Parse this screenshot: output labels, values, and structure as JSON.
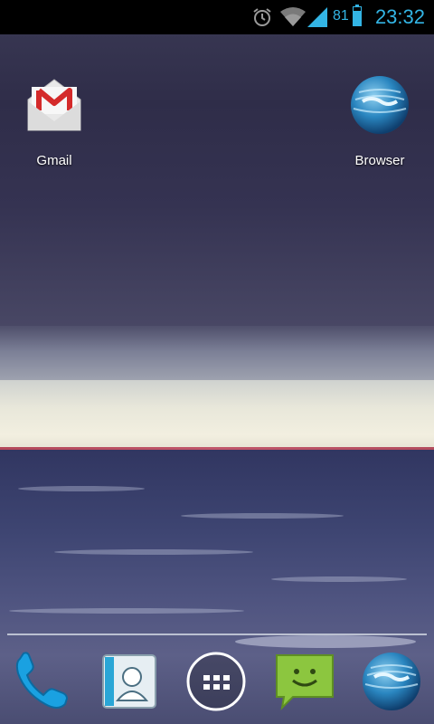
{
  "status_bar": {
    "time": "23:32",
    "battery_percent": "81",
    "battery_level": 0.81,
    "icons": [
      "alarm-icon",
      "wifi-icon",
      "signal-icon",
      "battery-icon"
    ],
    "accent_color": "#33b5e5"
  },
  "home_icons": [
    {
      "label": "Gmail",
      "icon": "gmail-icon"
    },
    {
      "label": "Browser",
      "icon": "browser-icon"
    }
  ],
  "dock": [
    {
      "icon": "phone-icon"
    },
    {
      "icon": "contacts-icon"
    },
    {
      "icon": "app-drawer-icon"
    },
    {
      "icon": "messaging-icon"
    },
    {
      "icon": "browser-icon"
    }
  ]
}
